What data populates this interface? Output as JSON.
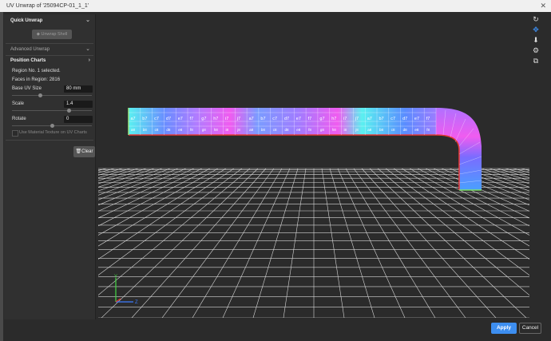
{
  "window": {
    "title": "UV Unwrap of '25094CP-01_1_1'",
    "close_glyph": "✕"
  },
  "panel": {
    "quick_unwrap": {
      "title": "Quick Unwrap",
      "button": "Unwrap Shell"
    },
    "advanced_unwrap": {
      "title": "Advanced Unwrap"
    },
    "position_charts": {
      "title": "Position Charts",
      "region_selected": "Region No. 1 selected.",
      "faces_in_region": "Faces in Region: 2816",
      "base_uv_size_label": "Base UV Size",
      "base_uv_size_value": "80 mm",
      "scale_label": "Scale",
      "scale_value": "1.4",
      "rotate_label": "Rotate",
      "rotate_value": "0",
      "use_material_label": "Use Material Texture on UV Charts",
      "clear_button": "Clear"
    }
  },
  "viewport": {
    "top_row_labels": [
      "a7",
      "b7",
      "c7",
      "d7",
      "e7",
      "f7",
      "g7",
      "h7",
      "i7",
      "j7",
      "a7",
      "b7",
      "c7",
      "d7",
      "e7",
      "f7",
      "g7",
      "h7",
      "i7",
      "j7",
      "a7",
      "b7",
      "c7",
      "d7",
      "e7",
      "f7"
    ],
    "bottom_row_labels": [
      "a8",
      "b8",
      "c8",
      "d8",
      "e8",
      "f8",
      "g8",
      "h8",
      "i8",
      "j8",
      "a8",
      "b8",
      "c8",
      "d8",
      "e8",
      "f8",
      "g8",
      "h8",
      "i8",
      "j8",
      "a8",
      "b8",
      "c8",
      "d8",
      "e8",
      "f8"
    ]
  },
  "toolbar": {
    "icons": [
      "refresh-icon",
      "arrows-icon",
      "download-icon",
      "settings-icon",
      "view-cube-icon"
    ]
  },
  "footer": {
    "apply": "Apply",
    "cancel": "Cancel"
  },
  "colors": {
    "accent": "#3d8ef0",
    "grid": "#dddddd",
    "red_edge": "#e53935",
    "green_edge": "#7ee06a"
  }
}
